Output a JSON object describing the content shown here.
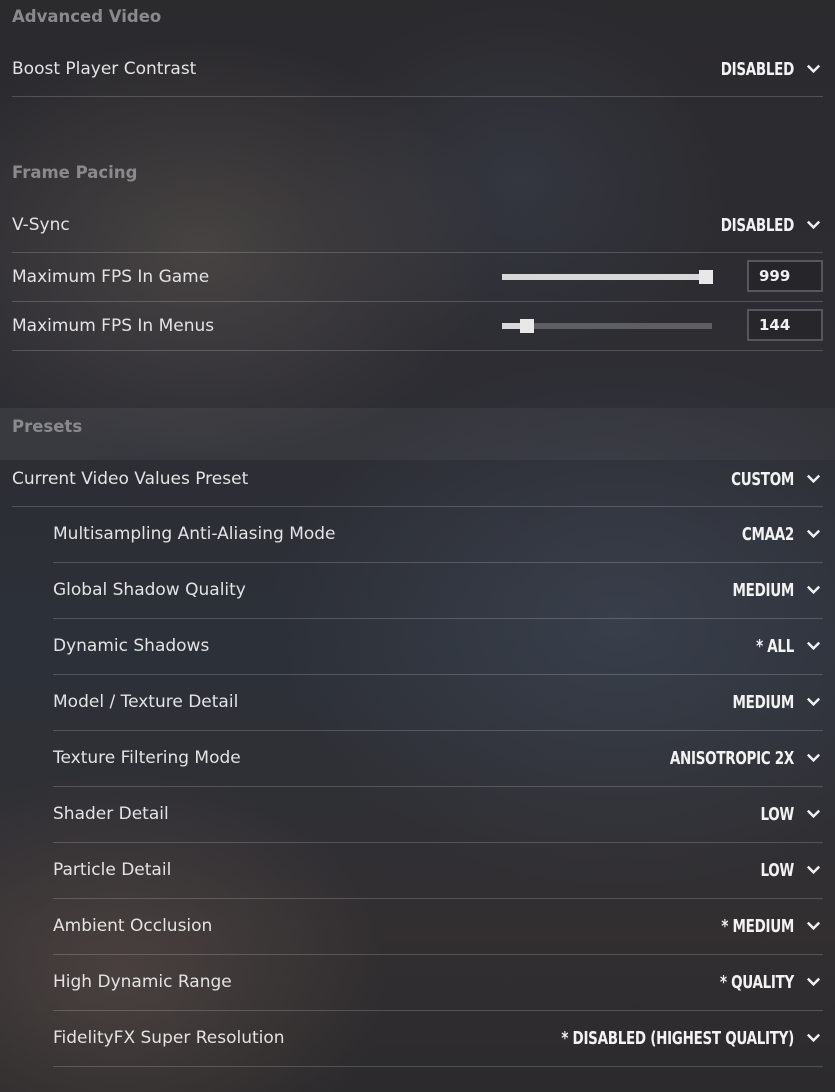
{
  "advanced_video": {
    "title": "Advanced Video",
    "boost_player_contrast": {
      "label": "Boost Player Contrast",
      "value": "DISABLED"
    }
  },
  "frame_pacing": {
    "title": "Frame Pacing",
    "vsync": {
      "label": "V-Sync",
      "value": "DISABLED"
    },
    "max_fps_game": {
      "label": "Maximum FPS In Game",
      "value": "999",
      "slider_fraction": 0.97
    },
    "max_fps_menus": {
      "label": "Maximum FPS In Menus",
      "value": "144",
      "slider_fraction": 0.12
    }
  },
  "presets": {
    "title": "Presets",
    "current_preset": {
      "label": "Current Video Values Preset",
      "value": "CUSTOM"
    },
    "settings": [
      {
        "label": "Multisampling Anti-Aliasing Mode",
        "value": "CMAA2"
      },
      {
        "label": "Global Shadow Quality",
        "value": "MEDIUM"
      },
      {
        "label": "Dynamic Shadows",
        "value": "* ALL"
      },
      {
        "label": "Model / Texture Detail",
        "value": "MEDIUM"
      },
      {
        "label": "Texture Filtering Mode",
        "value": "ANISOTROPIC 2X"
      },
      {
        "label": "Shader Detail",
        "value": "LOW"
      },
      {
        "label": "Particle Detail",
        "value": "LOW"
      },
      {
        "label": "Ambient Occlusion",
        "value": "* MEDIUM"
      },
      {
        "label": "High Dynamic Range",
        "value": "* QUALITY"
      },
      {
        "label": "FidelityFX Super Resolution",
        "value": "* DISABLED (HIGHEST QUALITY)"
      }
    ]
  },
  "icons": {
    "dropdown": "chevron-down-icon"
  },
  "colors": {
    "text": "#e3e3e3",
    "section_title": "#8a8a8c",
    "divider": "#4a4a4e",
    "slider_track": "#5d5f63",
    "slider_fill": "#d8d8d8"
  }
}
